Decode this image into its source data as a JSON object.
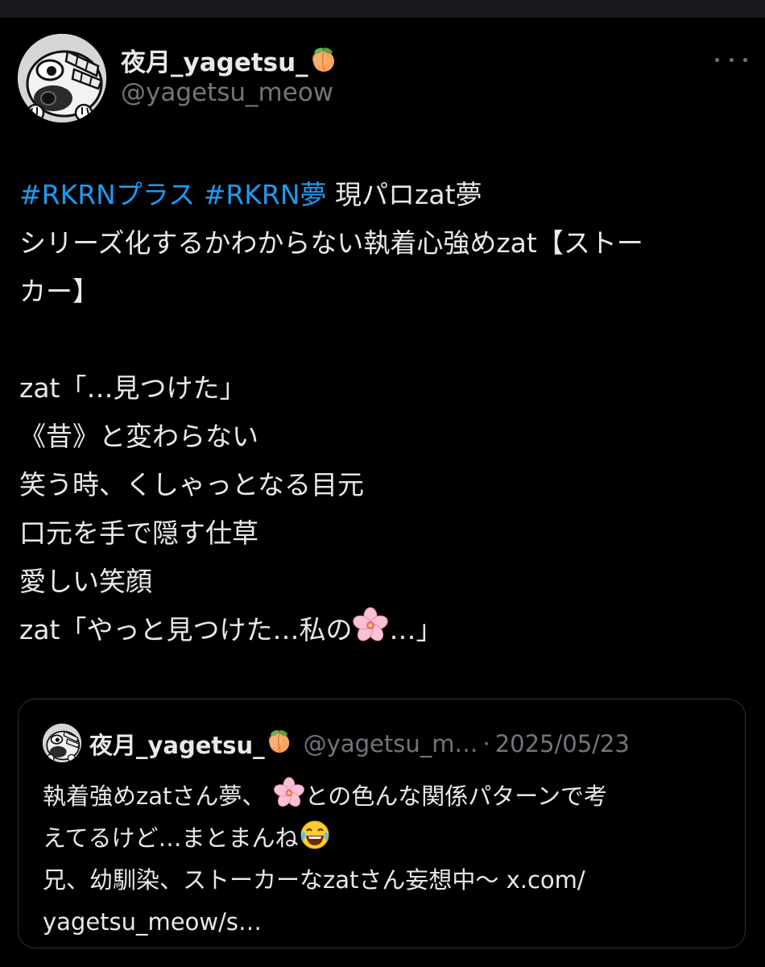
{
  "post": {
    "author": {
      "display_name": "夜月_yagetsu_",
      "name_emoji": "peach-icon",
      "handle": "@yagetsu_meow"
    },
    "body_lines": [
      {
        "hashtag1": "#RKRNプラス",
        "hashtag2": "#RKRN夢",
        "rest": " 現パロzat夢"
      },
      "シリーズ化するかわからない執着心強めzat【ストー",
      "カー】",
      "",
      "zat「…見つけた」",
      "《昔》と変わらない",
      "笑う時、くしゃっとなる目元",
      "口元を手で隠す仕草",
      "愛しい笑顔",
      {
        "before": "zat「やっと見つけた…私の",
        "emoji": "cherry-blossom-icon",
        "after": "…」"
      }
    ]
  },
  "quote": {
    "display_name": "夜月_yagetsu_",
    "name_emoji": "peach-icon",
    "handle": "@yagetsu_m…",
    "separator": "·",
    "date": "2025/05/23",
    "lines": [
      {
        "before": "執着強めzatさん夢、",
        "emoji": "cherry-blossom-icon",
        "after": "との色んな関係パターンで考"
      },
      {
        "before": "えてるけど…まとまんね",
        "emoji": "laughing-tears-icon",
        "after": ""
      },
      {
        "before": "兄、幼馴染、ストーカーなzatさん妄想中〜 x.com/",
        "emoji": "",
        "after": ""
      },
      {
        "before": "yagetsu_meow/s…",
        "emoji": "",
        "after": ""
      }
    ]
  },
  "colors": {
    "background": "#000000",
    "text": "#e7e9ea",
    "secondary": "#71767b",
    "accent": "#1d9bf0",
    "border": "#2f3336"
  }
}
